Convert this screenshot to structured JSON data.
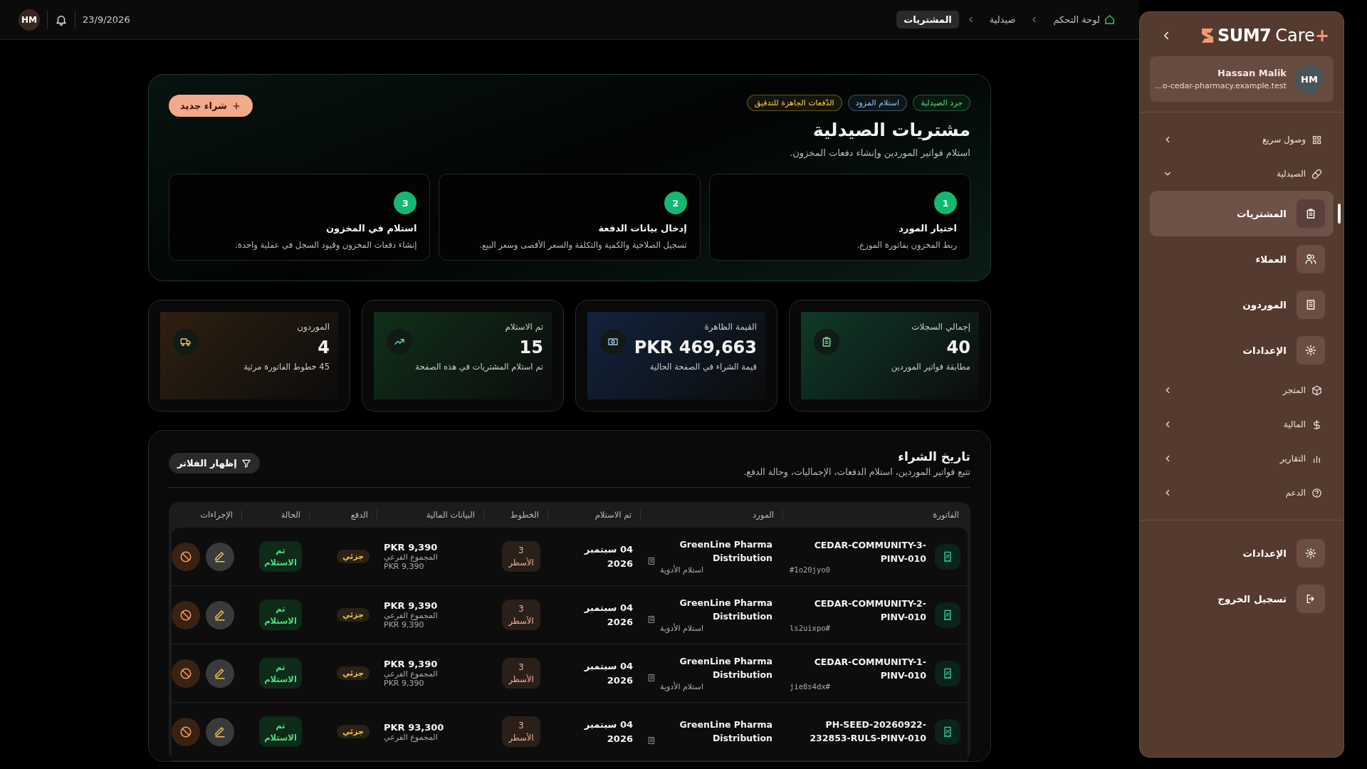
{
  "topbar": {
    "avatar": "HM",
    "date": "23/9/2026",
    "breadcrumbs": [
      {
        "label": "لوحة التحكم",
        "selected": false
      },
      {
        "label": "صيدلية",
        "selected": false
      },
      {
        "label": "المشتريات",
        "selected": true
      }
    ]
  },
  "hero": {
    "tags": [
      {
        "label": "جرد الصيدلية",
        "color": "#4ade80"
      },
      {
        "label": "استلام المزود",
        "color": "#93c5fd"
      },
      {
        "label": "الدّفعات الجاهزة للتدقيق",
        "color": "#fcd34d"
      }
    ],
    "title": "مشتريات الصيدلية",
    "subtitle": "استلام فواتير الموردين وإنشاء دفعات المخزون.",
    "new_button": "شراء جديد",
    "steps": [
      {
        "number": "1",
        "title": "اختيار المورد",
        "text": "ربط المخزون بفاتورة الموزع."
      },
      {
        "number": "2",
        "title": "إدخال بيانات الدفعة",
        "text": "تسجيل الصلاحية والكمية والتكلفة والسعر الأقصى وسعر البيع."
      },
      {
        "number": "3",
        "title": "استلام في المخزون",
        "text": "إنشاء دفعات المخزون وقيود السجل في عملية واحدة."
      }
    ]
  },
  "stats": [
    {
      "label": "إجمالي السجلات",
      "value": "40",
      "note": "مطابقة فواتير الموردين",
      "color": "#0f3a28"
    },
    {
      "label": "القيمة الظاهرة",
      "value": "PKR 469,663",
      "note": "قيمة الشراء في الصفحة الحالية",
      "color": "#12233d"
    },
    {
      "label": "تم الاستلام",
      "value": "15",
      "note": "تم استلام المشتريات في هذه الصفحة",
      "color": "#10301a"
    },
    {
      "label": "الموردون",
      "value": "4",
      "note": "45 خطوط الفاتورة مرئية",
      "color": "#2e2010"
    }
  ],
  "history": {
    "title": "تاريخ الشراء",
    "subtitle": "تتبع فواتير الموردين، استلام الدفعات، الإجماليات، وحالة الدفع.",
    "filter_button": "إظهار الفلاتر",
    "columns": [
      "الفاتورة",
      "المورد",
      "تم الاستلام",
      "الخطوط",
      "البيانات المالية",
      "الدفع",
      "الحالة",
      "الإجراءات"
    ],
    "rows": [
      {
        "invoice": "CEDAR-COMMUNITY-3-PINV-010",
        "hash": "#1o20jyo0",
        "supplier": "GreenLine Pharma Distribution",
        "supplier_note": "استلام الأدوية",
        "received": "04 سبتمبر 2026",
        "lines": "3 الأسطر",
        "amount": "PKR 9,390",
        "subtotal_label": "المجموع الفرعي",
        "subtotal": "PKR 9,390",
        "payment": "جزئي",
        "status": "تم الاستلام"
      },
      {
        "invoice": "CEDAR-COMMUNITY-2-PINV-010",
        "hash": "ls2uixpo#",
        "supplier": "GreenLine Pharma Distribution",
        "supplier_note": "استلام الأدوية",
        "received": "04 سبتمبر 2026",
        "lines": "3 الأسطر",
        "amount": "PKR 9,390",
        "subtotal_label": "المجموع الفرعي",
        "subtotal": "PKR 9,390",
        "payment": "جزئي",
        "status": "تم الاستلام"
      },
      {
        "invoice": "CEDAR-COMMUNITY-1-PINV-010",
        "hash": "jie8s4dx#",
        "supplier": "GreenLine Pharma Distribution",
        "supplier_note": "استلام الأدوية",
        "received": "04 سبتمبر 2026",
        "lines": "3 الأسطر",
        "amount": "PKR 9,390",
        "subtotal_label": "المجموع الفرعي",
        "subtotal": "PKR 9,390",
        "payment": "جزئي",
        "status": "تم الاستلام"
      },
      {
        "invoice": "PH-SEED-20260922-232853-RULS-PINV-010",
        "supplier": "GreenLine Pharma Distribution",
        "received": "04 سبتمبر 2026",
        "lines": "3 الأسطر",
        "amount": "PKR 93,300",
        "subtotal_label": "المجموع الفرعي",
        "payment": "جزئي",
        "status": "تم الاستلام"
      }
    ]
  },
  "sidebar": {
    "brand": "SUM7",
    "brand_suffix": "Care",
    "brand_plus": "+",
    "user": {
      "avatar": "HM",
      "name": "Hassan Malik",
      "email": "...o-cedar-pharmacy.example.test"
    },
    "nav": [
      {
        "label": "وصول سريع",
        "kind": "group",
        "expanded": false
      },
      {
        "label": "الصيدلية",
        "kind": "group",
        "expanded": true,
        "children": [
          {
            "label": "المشتريات",
            "kind": "link",
            "selected": true
          },
          {
            "label": "العملاء",
            "kind": "link",
            "selected": false
          },
          {
            "label": "الموردون",
            "kind": "link",
            "selected": false
          },
          {
            "label": "الإعدادات",
            "kind": "link",
            "selected": false
          }
        ]
      },
      {
        "label": "المتجر",
        "kind": "group",
        "expanded": false
      },
      {
        "label": "المالية",
        "kind": "group",
        "expanded": false
      },
      {
        "label": "التقارير",
        "kind": "group",
        "expanded": false
      },
      {
        "label": "الدعم",
        "kind": "group",
        "expanded": false
      }
    ],
    "footer": [
      {
        "label": "الإعدادات",
        "kind": "link",
        "selected": false
      },
      {
        "label": "تسجيل الخروج",
        "kind": "link",
        "selected": false
      }
    ]
  }
}
